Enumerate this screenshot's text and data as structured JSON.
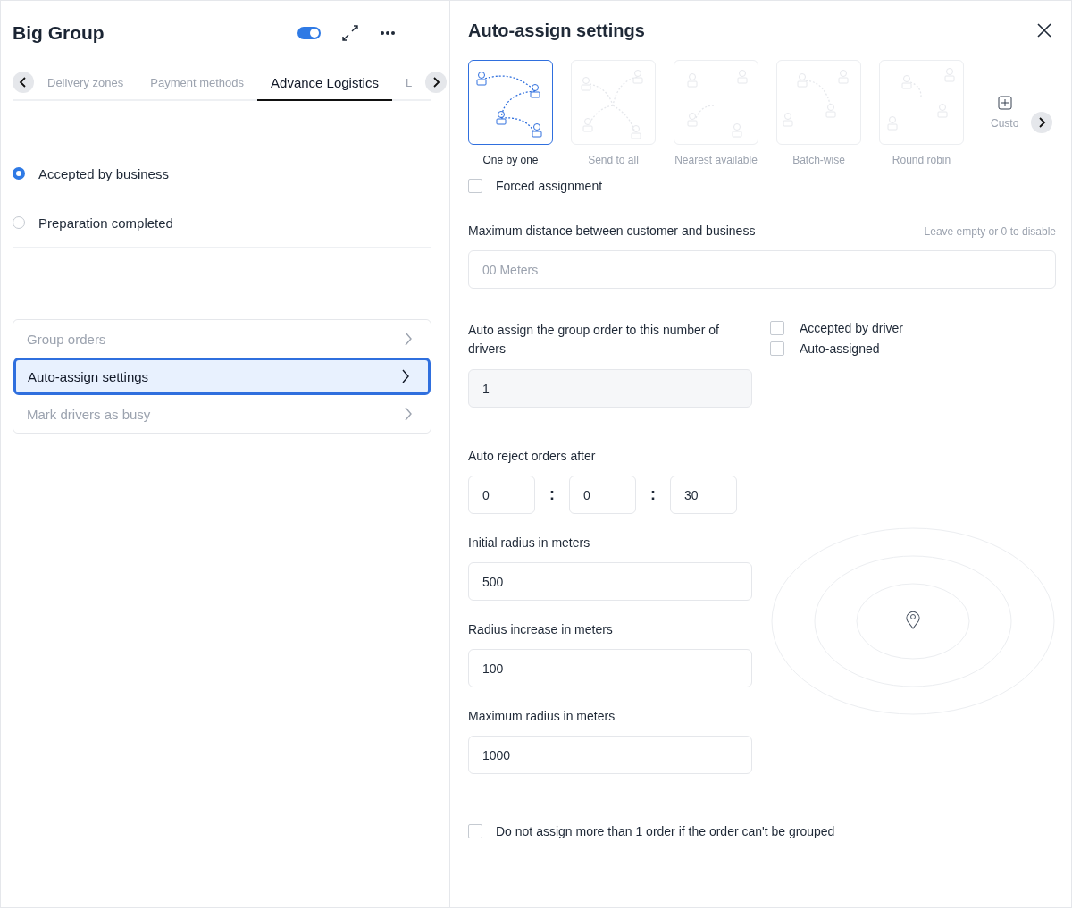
{
  "header": {
    "title": "Big Group",
    "toggle": {
      "on": true
    }
  },
  "tabs": [
    {
      "label": "Delivery zones",
      "selected": false
    },
    {
      "label": "Payment methods",
      "selected": false
    },
    {
      "label": "Advance Logistics",
      "selected": true
    },
    {
      "label": "L",
      "selected": false
    }
  ],
  "trigger_options": [
    {
      "label": "Accepted by business",
      "selected": true
    },
    {
      "label": "Preparation completed",
      "selected": false
    }
  ],
  "menu": [
    {
      "label": "Group orders",
      "selected": false
    },
    {
      "label": "Auto-assign settings",
      "selected": true
    },
    {
      "label": "Mark drivers as busy",
      "selected": false
    }
  ],
  "settings": {
    "title": "Auto-assign settings",
    "strategies": [
      {
        "label": "One by one",
        "selected": true
      },
      {
        "label": "Send to all",
        "selected": false
      },
      {
        "label": "Nearest available",
        "selected": false
      },
      {
        "label": "Batch-wise",
        "selected": false
      },
      {
        "label": "Round robin",
        "selected": false
      }
    ],
    "custom": {
      "label": "Custo"
    },
    "forced_assignment": {
      "label": "Forced assignment",
      "checked": false
    },
    "max_distance": {
      "label": "Maximum distance between customer and business",
      "hint": "Leave empty or 0 to disable",
      "placeholder": "00 Meters"
    },
    "driver_count": {
      "label": "Auto assign the group order to this number of drivers",
      "value": "1"
    },
    "driver_conditions": [
      {
        "label": "Accepted by driver",
        "checked": false
      },
      {
        "label": "Auto-assigned",
        "checked": false
      }
    ],
    "auto_reject": {
      "label": "Auto reject orders after",
      "values": [
        "0",
        "0",
        "30"
      ],
      "separators": [
        ":",
        ":"
      ]
    },
    "radius_fields": [
      {
        "label": "Initial radius in meters",
        "value": "500"
      },
      {
        "label": "Radius increase in meters",
        "value": "100"
      },
      {
        "label": "Maximum radius in meters",
        "value": "1000"
      }
    ],
    "single_order": {
      "label": "Do not assign more than 1 order if the order can't be grouped",
      "checked": false
    }
  }
}
